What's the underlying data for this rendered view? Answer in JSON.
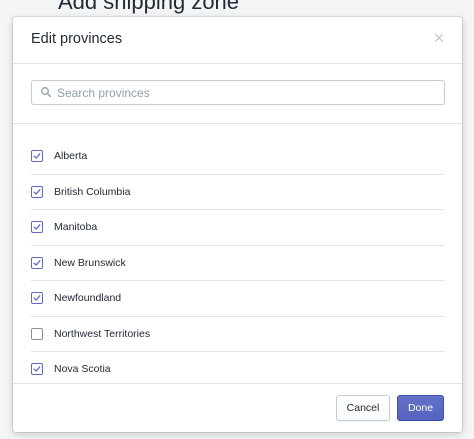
{
  "backdrop": {
    "title": "Add shipping zone"
  },
  "modal": {
    "title": "Edit provinces",
    "close_icon": "close-icon"
  },
  "search": {
    "placeholder": "Search provinces",
    "value": "",
    "icon": "search-icon"
  },
  "provinces": [
    {
      "label": "Alberta",
      "checked": true
    },
    {
      "label": "British Columbia",
      "checked": true
    },
    {
      "label": "Manitoba",
      "checked": true
    },
    {
      "label": "New Brunswick",
      "checked": true
    },
    {
      "label": "Newfoundland",
      "checked": true
    },
    {
      "label": "Northwest Territories",
      "checked": false
    },
    {
      "label": "Nova Scotia",
      "checked": true
    }
  ],
  "footer": {
    "cancel_label": "Cancel",
    "done_label": "Done"
  },
  "colors": {
    "accent": "#5c6ac4",
    "border": "#dfe3e8",
    "text": "#212b36"
  }
}
